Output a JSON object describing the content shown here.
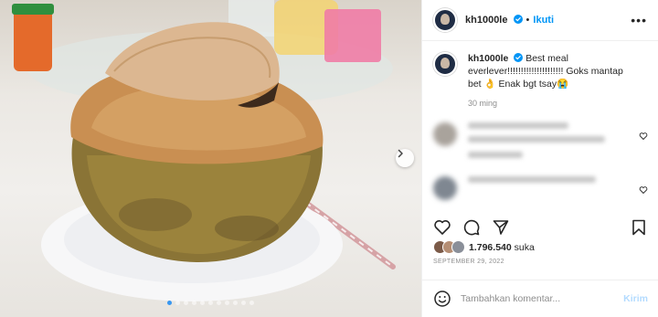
{
  "post": {
    "username": "kh1000le",
    "follow_label": "Ikuti",
    "separator": "•",
    "more_icon": "more-horizontal-icon",
    "caption_line1": "Best meal",
    "caption_line2": "everlever!!!!!!!!!!!!!!!!!!!!! Goks mantap",
    "caption_line3": "bet 👌 Enak bgt tsay😭",
    "caption_time": "30 ming",
    "likes_count": "1.796.540",
    "likes_unit": "suka",
    "date": "SEPTEMBER 29, 2022",
    "comment_placeholder": "Tambahkan komentar...",
    "post_button": "Kirim",
    "carousel": {
      "count": 11,
      "active_index": 0
    }
  },
  "colors": {
    "link_blue": "#0095f6",
    "verified_blue": "#0095f6",
    "muted_text": "#8e8e8e",
    "disabled_post": "#b3dbff"
  },
  "icons": [
    "verified-badge-icon",
    "heart-icon",
    "comment-icon",
    "share-icon",
    "bookmark-icon",
    "emoji-icon",
    "chevron-right-icon"
  ]
}
